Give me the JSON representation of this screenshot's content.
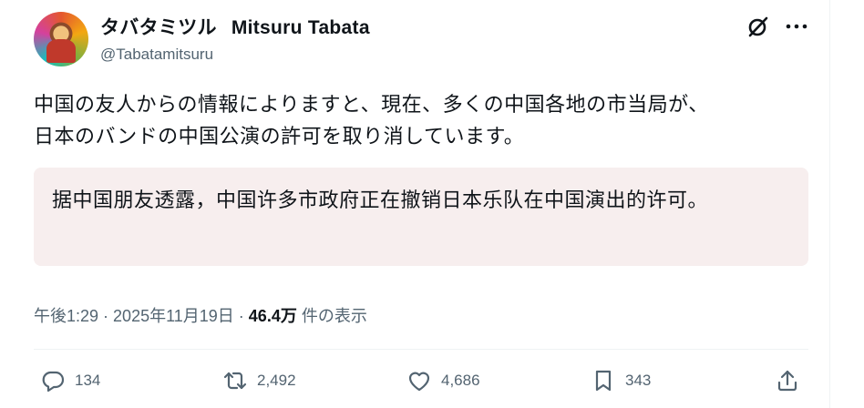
{
  "author": {
    "display_name_jp": "タバタミツル",
    "display_name_latin": "Mitsuru Tabata",
    "handle": "@Tabatamitsuru"
  },
  "tweet": {
    "text_line1": "中国の友人からの情報によりますと、現在、多くの中国各地の市当局が、",
    "text_line2": "日本のバンドの中国公演の許可を取り消しています。",
    "translation": "据中国朋友透露，中国许多市政府正在撤销日本乐队在中国演出的许可。"
  },
  "meta": {
    "time": "午後1:29",
    "sep1": " · ",
    "date": "2025年11月19日",
    "sep2": " · ",
    "views_count": "46.4万",
    "views_label": " 件の表示"
  },
  "actions": {
    "replies": "134",
    "retweets": "2,492",
    "likes": "4,686",
    "bookmarks": "343"
  },
  "icons": {
    "grok": "grok-icon",
    "more": "more-icon",
    "reply": "reply-icon",
    "retweet": "retweet-icon",
    "like": "heart-icon",
    "bookmark": "bookmark-icon",
    "share": "share-icon"
  },
  "colors": {
    "text_primary": "#0f1419",
    "text_secondary": "#536471",
    "translation_bg": "#f7eeee"
  }
}
